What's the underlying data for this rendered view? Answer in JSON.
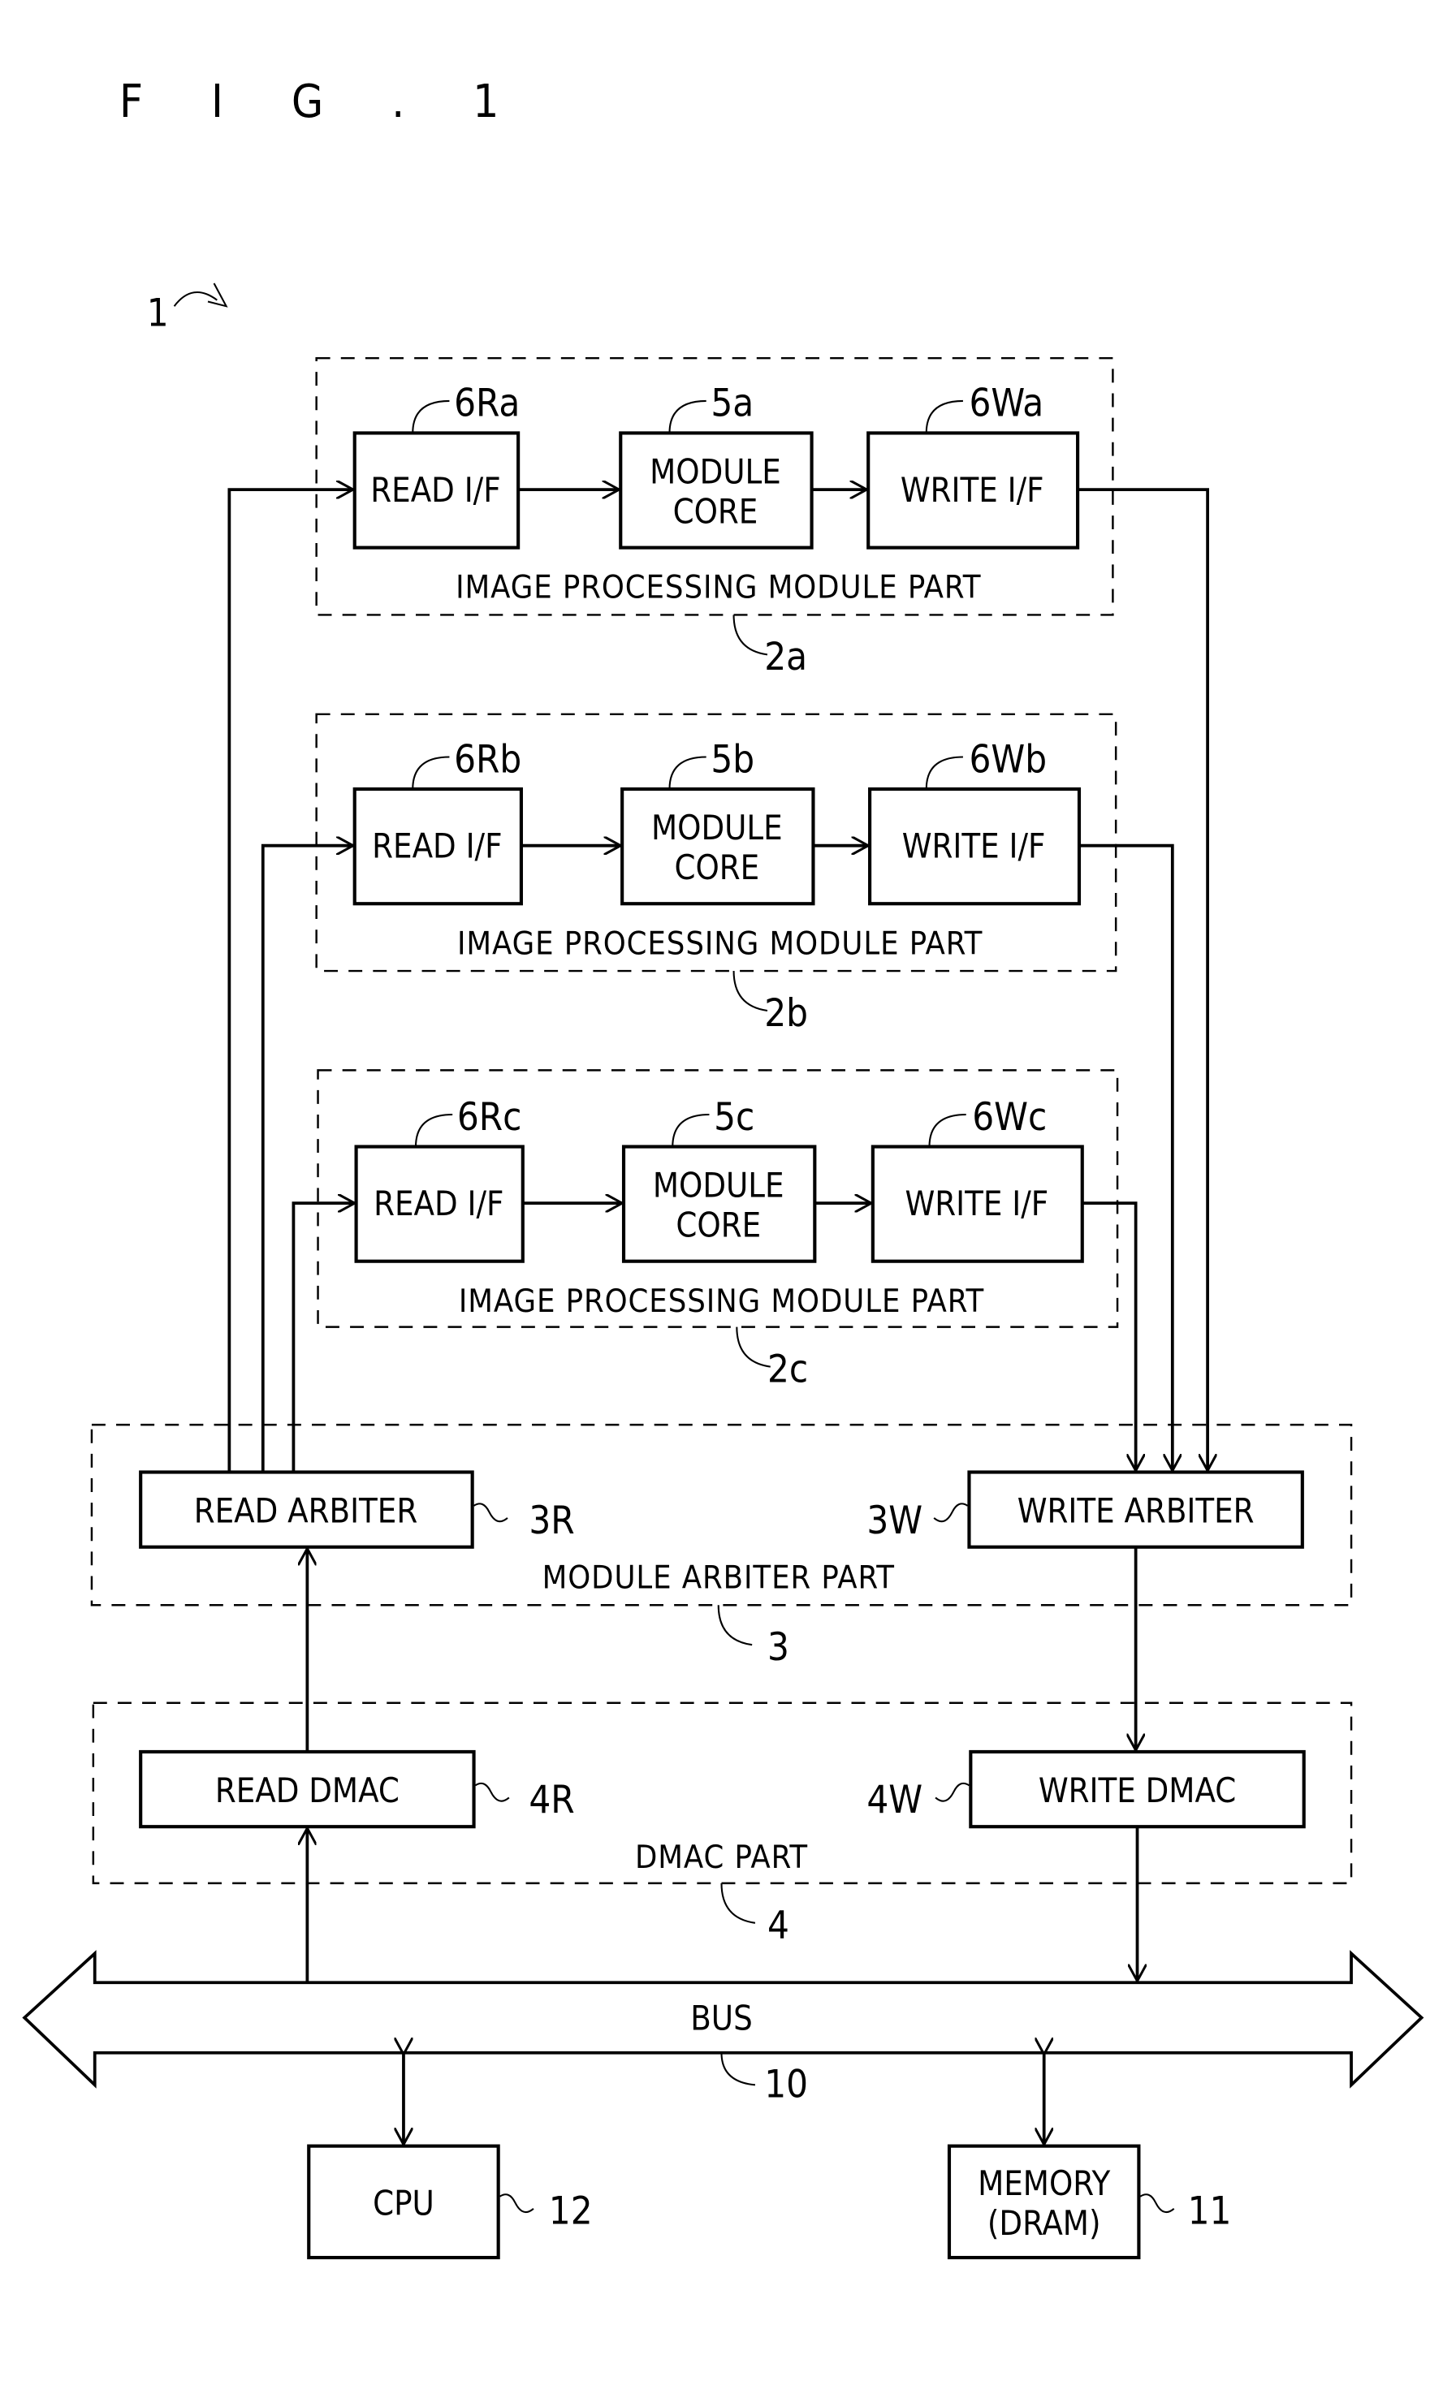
{
  "figure": {
    "title": "F I G . 1",
    "system_ref": "1"
  },
  "modules": [
    {
      "ref": "2a",
      "label": "IMAGE PROCESSING MODULE PART",
      "read_if": {
        "ref": "6Ra",
        "label": "READ I/F"
      },
      "core": {
        "ref": "5a",
        "label_line1": "MODULE",
        "label_line2": "CORE"
      },
      "write_if": {
        "ref": "6Wa",
        "label": "WRITE I/F"
      }
    },
    {
      "ref": "2b",
      "label": "IMAGE PROCESSING MODULE PART",
      "read_if": {
        "ref": "6Rb",
        "label": "READ I/F"
      },
      "core": {
        "ref": "5b",
        "label_line1": "MODULE",
        "label_line2": "CORE"
      },
      "write_if": {
        "ref": "6Wb",
        "label": "WRITE I/F"
      }
    },
    {
      "ref": "2c",
      "label": "IMAGE PROCESSING MODULE PART",
      "read_if": {
        "ref": "6Rc",
        "label": "READ I/F"
      },
      "core": {
        "ref": "5c",
        "label_line1": "MODULE",
        "label_line2": "CORE"
      },
      "write_if": {
        "ref": "6Wc",
        "label": "WRITE I/F"
      }
    }
  ],
  "arbiter_part": {
    "ref": "3",
    "label": "MODULE ARBITER PART",
    "read": {
      "ref": "3R",
      "label": "READ ARBITER"
    },
    "write": {
      "ref": "3W",
      "label": "WRITE ARBITER"
    }
  },
  "dmac_part": {
    "ref": "4",
    "label": "DMAC PART",
    "read": {
      "ref": "4R",
      "label": "READ DMAC"
    },
    "write": {
      "ref": "4W",
      "label": "WRITE DMAC"
    }
  },
  "bus": {
    "ref": "10",
    "label": "BUS"
  },
  "cpu": {
    "ref": "12",
    "label": "CPU"
  },
  "memory": {
    "ref": "11",
    "label_line1": "MEMORY",
    "label_line2": "(DRAM)"
  }
}
